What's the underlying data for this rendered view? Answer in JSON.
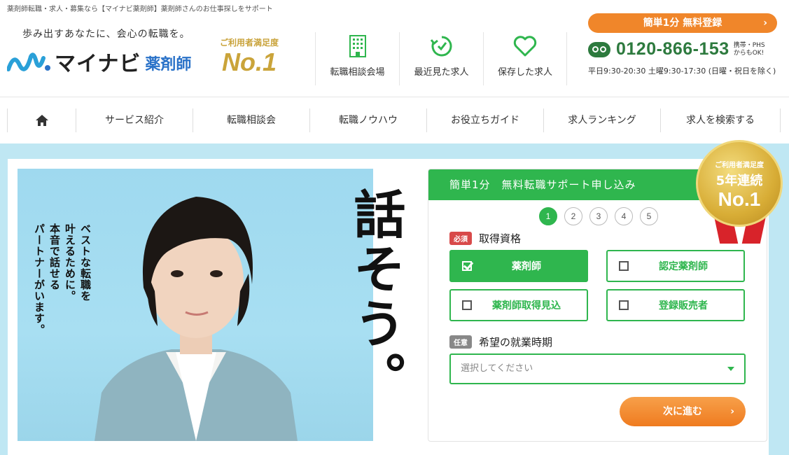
{
  "top_text": "薬剤師転職・求人・募集なら【マイナビ薬剤師】薬剤師さんのお仕事探しをサポート",
  "header": {
    "tagline": "歩み出すあなたに、会心の転職を。",
    "logo_text": "マイナビ",
    "logo_sub": "薬剤師",
    "satisfaction_label": "ご利用者満足度",
    "satisfaction_rank": "No.1",
    "nav": [
      {
        "label": "転職相談会場",
        "icon": "building-icon"
      },
      {
        "label": "最近見た求人",
        "icon": "history-icon"
      },
      {
        "label": "保存した求人",
        "icon": "heart-icon"
      }
    ],
    "register_button": "簡単1分 無料登録",
    "phone": "0120-866-153",
    "phone_note_1": "携帯・PHS",
    "phone_note_2": "からもOK!",
    "hours": "平日9:30-20:30 土曜9:30-17:30 (日曜・祝日を除く)"
  },
  "global_nav": [
    {
      "label": "",
      "icon": "home-icon"
    },
    {
      "label": "サービス紹介"
    },
    {
      "label": "転職相談会"
    },
    {
      "label": "転職ノウハウ"
    },
    {
      "label": "お役立ちガイド"
    },
    {
      "label": "求人ランキング"
    },
    {
      "label": "求人を検索する"
    }
  ],
  "hero": {
    "copy_lines": [
      "ベストな転職を",
      "叶えるために。",
      "本音で話せる",
      "パートナーがいます。"
    ],
    "big_copy": "話そう。"
  },
  "form": {
    "title": "簡単1分　無料転職サポート申し込み",
    "steps": [
      "1",
      "2",
      "3",
      "4",
      "5"
    ],
    "current_step": 1,
    "q1": {
      "badge": "必須",
      "label": "取得資格"
    },
    "options": [
      {
        "label": "薬剤師",
        "checked": true
      },
      {
        "label": "認定薬剤師",
        "checked": false
      },
      {
        "label": "薬剤師取得見込",
        "checked": false
      },
      {
        "label": "登録販売者",
        "checked": false
      }
    ],
    "q2": {
      "badge": "任意",
      "label": "希望の就業時期"
    },
    "select_placeholder": "選択してください",
    "next_button": "次に進む"
  },
  "medal": {
    "line1": "ご利用者満足度",
    "line2": "5年連続",
    "line3": "No.1"
  },
  "colors": {
    "green": "#2fb64e",
    "orange": "#f0862a",
    "phone_green": "#2d7a3e",
    "gold": "#caa43a",
    "band": "#bfe7f3"
  }
}
